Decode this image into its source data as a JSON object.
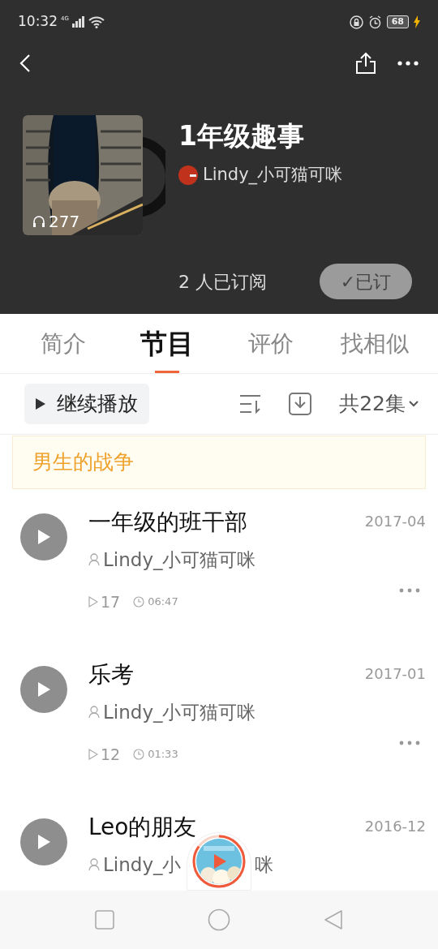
{
  "status_bar": {
    "time": "10:32",
    "network": "4G",
    "battery": "68",
    "charging": true
  },
  "album": {
    "title": "1年级趣事",
    "author": "Lindy_小可猫可咪",
    "plays": "277",
    "subscribers": "2 人已订阅",
    "subscribe_button": "✓已订",
    "subscribed": true
  },
  "tabs": [
    {
      "label": "简介",
      "selected": false
    },
    {
      "label": "节目",
      "selected": true
    },
    {
      "label": "评价",
      "selected": false
    },
    {
      "label": "找相似",
      "selected": false
    }
  ],
  "toolbar": {
    "continue_button": "继续播放",
    "episode_count": "共22集"
  },
  "last_played": "男生的战争",
  "episodes": [
    {
      "title": "一年级的班干部",
      "date": "2017-04",
      "author": "Lindy_小可猫可咪",
      "plays": "17",
      "duration": "06:47"
    },
    {
      "title": "乐考",
      "date": "2017-01",
      "author": "Lindy_小可猫可咪",
      "plays": "12",
      "duration": "01:33"
    },
    {
      "title": "Leo的朋友",
      "date": "2016-12",
      "author_parts": [
        "Lindy_小",
        "咪"
      ]
    }
  ]
}
